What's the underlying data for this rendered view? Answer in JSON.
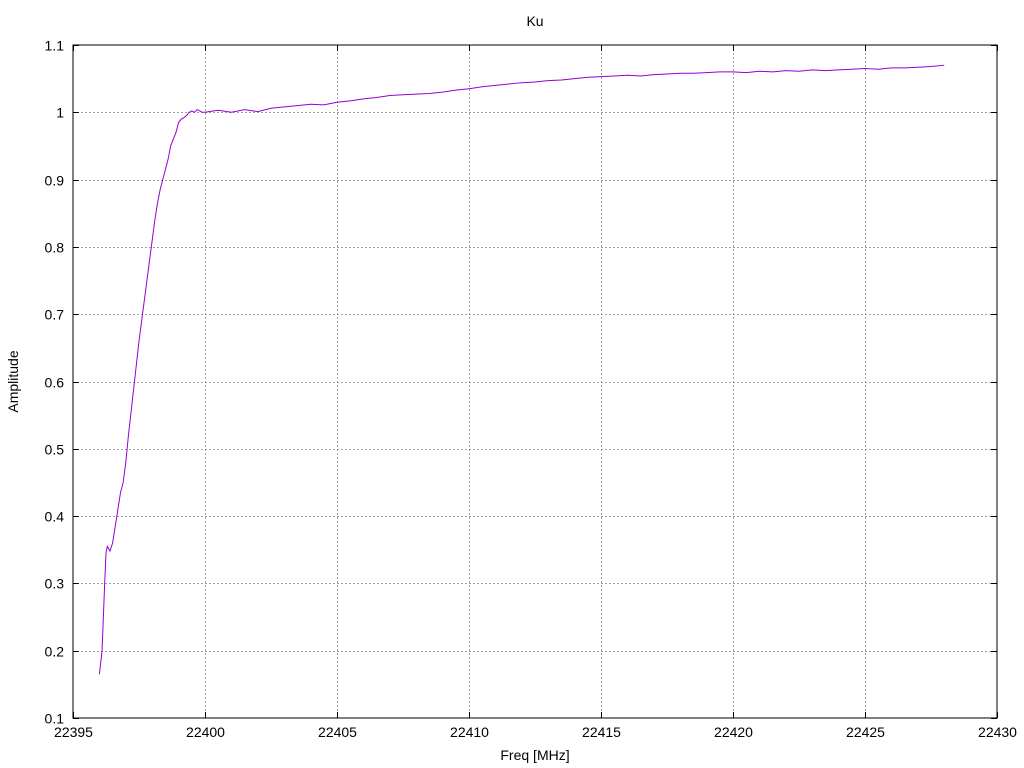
{
  "chart_data": {
    "type": "line",
    "title": "Ku",
    "xlabel": "Freq [MHz]",
    "ylabel": "Amplitude",
    "xlim": [
      22395,
      22430
    ],
    "ylim": [
      0.1,
      1.1
    ],
    "xticks": [
      22395,
      22400,
      22405,
      22410,
      22415,
      22420,
      22425,
      22430
    ],
    "yticks": [
      0.1,
      0.2,
      0.3,
      0.4,
      0.5,
      0.6,
      0.7,
      0.8,
      0.9,
      1,
      1.1
    ],
    "xtick_labels": [
      "22395",
      "22400",
      "22405",
      "22410",
      "22415",
      "22420",
      "22425",
      "22430"
    ],
    "ytick_labels": [
      "0.1",
      "0.2",
      "0.3",
      "0.4",
      "0.5",
      "0.6",
      "0.7",
      "0.8",
      "0.9",
      "1",
      "1.1"
    ],
    "grid": true,
    "legend": "none",
    "series": [
      {
        "color": "#9400d3",
        "x": [
          22396.0,
          22396.1,
          22396.2,
          22396.25,
          22396.3,
          22396.4,
          22396.5,
          22396.6,
          22396.7,
          22396.8,
          22396.9,
          22397.0,
          22397.1,
          22397.2,
          22397.3,
          22397.4,
          22397.5,
          22397.6,
          22397.7,
          22397.8,
          22397.9,
          22398.0,
          22398.1,
          22398.2,
          22398.3,
          22398.4,
          22398.5,
          22398.6,
          22398.7,
          22398.8,
          22398.9,
          22399.0,
          22399.1,
          22399.2,
          22399.3,
          22399.4,
          22399.5,
          22399.6,
          22399.7,
          22399.8,
          22399.9,
          22400.0,
          22400.5,
          22401.0,
          22401.5,
          22402.0,
          22402.5,
          22403.0,
          22403.5,
          22404.0,
          22404.5,
          22405.0,
          22405.5,
          22406.0,
          22406.5,
          22407.0,
          22407.5,
          22408.0,
          22408.5,
          22409.0,
          22409.5,
          22410.0,
          22410.5,
          22411.0,
          22411.5,
          22412.0,
          22412.5,
          22413.0,
          22413.5,
          22414.0,
          22414.5,
          22415.0,
          22415.5,
          22416.0,
          22416.5,
          22417.0,
          22417.5,
          22418.0,
          22418.5,
          22419.0,
          22419.5,
          22420.0,
          22420.5,
          22421.0,
          22421.5,
          22422.0,
          22422.5,
          22423.0,
          22423.5,
          22424.0,
          22424.5,
          22425.0,
          22425.5,
          22426.0,
          22426.5,
          22427.0,
          22427.5,
          22428.0
        ],
        "y": [
          0.165,
          0.2,
          0.3,
          0.345,
          0.355,
          0.348,
          0.36,
          0.385,
          0.41,
          0.435,
          0.45,
          0.48,
          0.52,
          0.555,
          0.59,
          0.625,
          0.66,
          0.69,
          0.72,
          0.75,
          0.78,
          0.81,
          0.84,
          0.865,
          0.885,
          0.9,
          0.915,
          0.93,
          0.95,
          0.96,
          0.97,
          0.985,
          0.99,
          0.992,
          0.995,
          1.0,
          1.002,
          1.0,
          1.004,
          1.002,
          1.0,
          1.0,
          1.003,
          1.0,
          1.004,
          1.001,
          1.006,
          1.008,
          1.01,
          1.012,
          1.011,
          1.015,
          1.017,
          1.02,
          1.022,
          1.025,
          1.026,
          1.027,
          1.028,
          1.03,
          1.033,
          1.035,
          1.038,
          1.04,
          1.042,
          1.044,
          1.045,
          1.047,
          1.048,
          1.05,
          1.052,
          1.053,
          1.054,
          1.055,
          1.054,
          1.056,
          1.057,
          1.058,
          1.058,
          1.059,
          1.06,
          1.06,
          1.059,
          1.061,
          1.06,
          1.062,
          1.061,
          1.063,
          1.062,
          1.063,
          1.064,
          1.065,
          1.064,
          1.066,
          1.066,
          1.067,
          1.068,
          1.07
        ]
      }
    ]
  }
}
